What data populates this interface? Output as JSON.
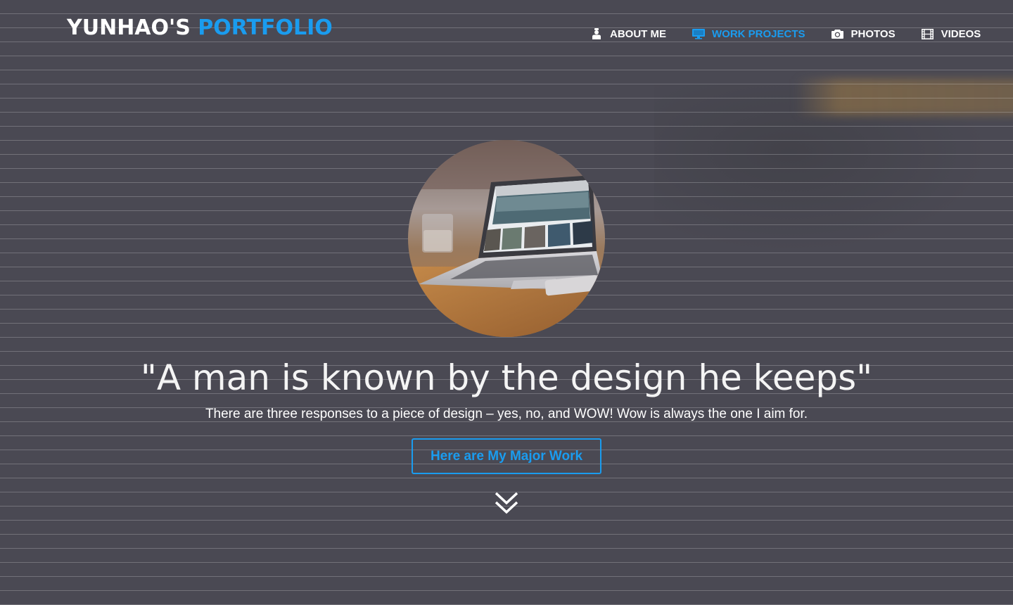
{
  "brand": {
    "name": "YUNHAO'S",
    "accent": "PORTFOLIO"
  },
  "nav": {
    "items": [
      {
        "label": "ABOUT ME",
        "icon": "user-icon",
        "active": false
      },
      {
        "label": "WORK PROJECTS",
        "icon": "monitor-icon",
        "active": true
      },
      {
        "label": "PHOTOS",
        "icon": "camera-icon",
        "active": false
      },
      {
        "label": "VIDEOS",
        "icon": "film-icon",
        "active": false
      }
    ]
  },
  "hero": {
    "image": "laptop-on-desk",
    "quote": "\"A man is known by the design he keeps\"",
    "tagline": "There are three responses to a piece of design – yes, no, and WOW! Wow is always the one I aim for.",
    "cta_label": "Here are My Major Work",
    "scroll_icon": "double-chevron-down-icon"
  },
  "colors": {
    "background": "#4a4953",
    "accent": "#1a9cef",
    "text": "#ffffff"
  }
}
